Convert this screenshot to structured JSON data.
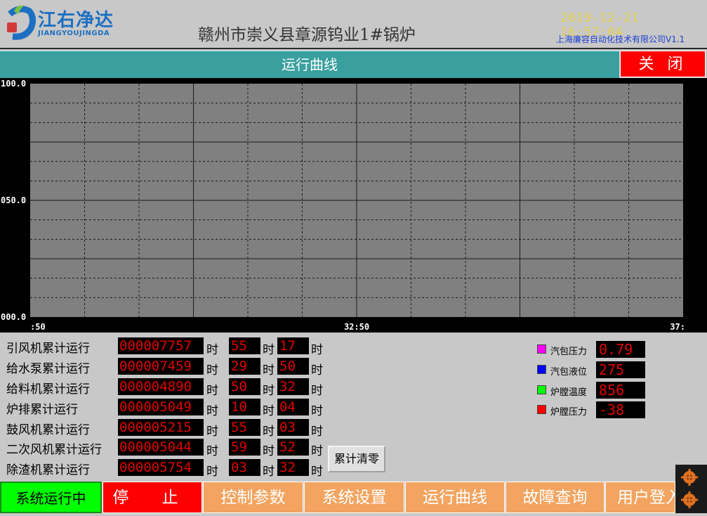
{
  "header": {
    "logo_cn": "江右净达",
    "logo_en": "JIANGYOUJINGDA",
    "title": "赣州市崇义县章源钨业1#锅炉",
    "datetime": "2019-12-21 16:57:04",
    "company": "上海廉容自动化技术有限公司V1.1"
  },
  "titlebar": {
    "label": "运行曲线",
    "close_label": "关  闭"
  },
  "chart_data": {
    "type": "line",
    "y_ticks": [
      "100.0",
      "050.0",
      "000.0"
    ],
    "x_ticks": [
      ":50",
      "32:50",
      "37:"
    ],
    "ylim": [
      0,
      100
    ],
    "grid": true,
    "series": []
  },
  "counters": [
    {
      "label": "引风机累计运行",
      "total": "000007757",
      "hours": "55",
      "minutes": "17"
    },
    {
      "label": "给水泵累计运行",
      "total": "000007459",
      "hours": "29",
      "minutes": "50"
    },
    {
      "label": "给料机累计运行",
      "total": "000004890",
      "hours": "50",
      "minutes": "32"
    },
    {
      "label": "炉排累计运行",
      "total": "000005049",
      "hours": "10",
      "minutes": "04"
    },
    {
      "label": "鼓风机累计运行",
      "total": "000005215",
      "hours": "55",
      "minutes": "03"
    },
    {
      "label": "二次风机累计运行",
      "total": "000005044",
      "hours": "59",
      "minutes": "52"
    },
    {
      "label": "除渣机累计运行",
      "total": "000005754",
      "hours": "03",
      "minutes": "32"
    }
  ],
  "unit": "时",
  "reset_label": "累计清零",
  "legend": [
    {
      "label": "汽包压力",
      "value": "0.79",
      "color": "#ff00ff"
    },
    {
      "label": "汽包液位",
      "value": "275",
      "color": "#0000ff"
    },
    {
      "label": "炉膛温度",
      "value": "856",
      "color": "#00ff00"
    },
    {
      "label": "炉膛压力",
      "value": "-38",
      "color": "#ff0000"
    }
  ],
  "nav": {
    "status": "系统运行中",
    "stop": "停 止",
    "params": "控制参数",
    "settings": "系统设置",
    "curves": "运行曲线",
    "faults": "故障查询",
    "login": "用户登入"
  }
}
